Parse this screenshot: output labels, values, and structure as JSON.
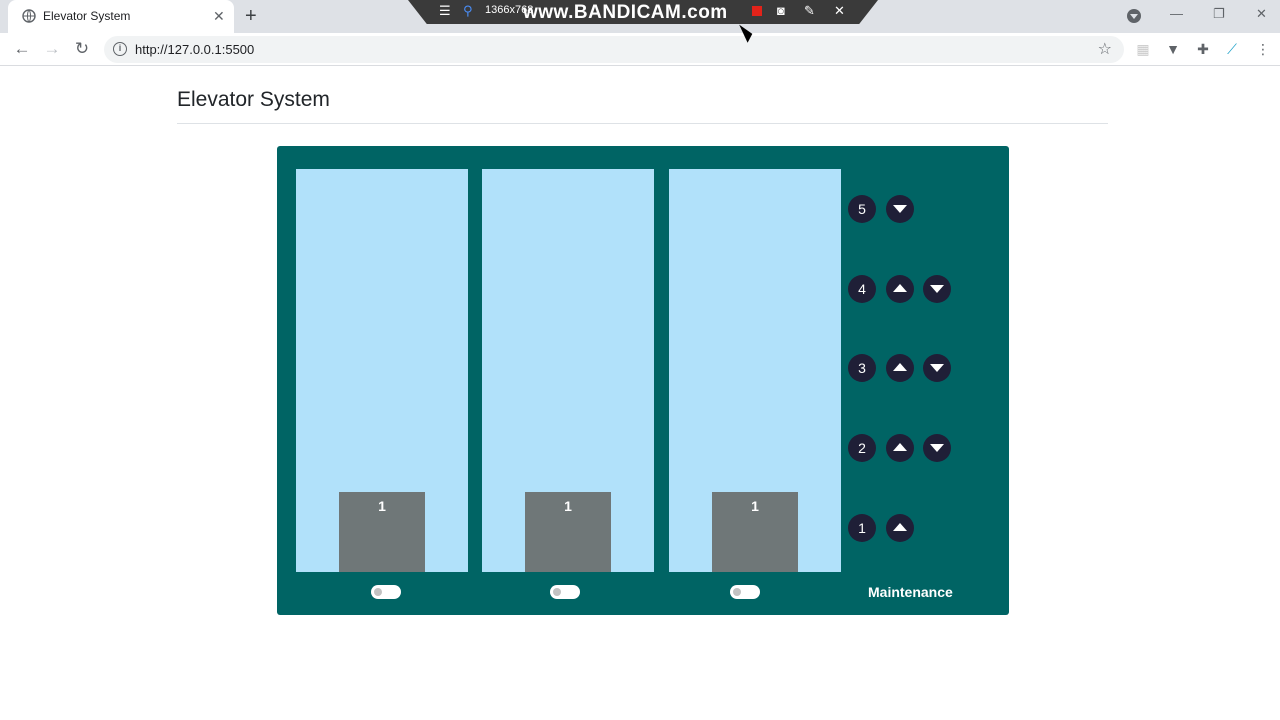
{
  "browser": {
    "tab_title": "Elevator System",
    "tab_close": "✕",
    "new_tab": "+",
    "url": "http://127.0.0.1:5500",
    "info_glyph": "i",
    "bookmark_star": "☆",
    "window_controls": {
      "minimize": "—",
      "restore": "❐",
      "close": "✕"
    },
    "nav": {
      "back": "←",
      "forward": "→",
      "reload": "↻"
    },
    "extensions": [
      "▦",
      "▼",
      "✚",
      "⟋",
      "⋮"
    ]
  },
  "recorder": {
    "menu_glyph": "☰",
    "pin_glyph": "⚲",
    "resolution": "1366x768",
    "watermark": "www.BANDICAM.com",
    "camera_glyph": "◙",
    "pen_glyph": "✎",
    "close_glyph": "✕"
  },
  "page": {
    "title": "Elevator System"
  },
  "elevators": [
    {
      "current_floor": "1",
      "maintenance": false
    },
    {
      "current_floor": "1",
      "maintenance": false
    },
    {
      "current_floor": "1",
      "maintenance": false
    }
  ],
  "floors": [
    {
      "number": "5",
      "up": false,
      "down": true
    },
    {
      "number": "4",
      "up": true,
      "down": true
    },
    {
      "number": "3",
      "up": true,
      "down": true
    },
    {
      "number": "2",
      "up": true,
      "down": true
    },
    {
      "number": "1",
      "up": true,
      "down": false
    }
  ],
  "maintenance_label": "Maintenance",
  "colors": {
    "panel": "#006464",
    "shaft": "#b1e1fa",
    "car": "#6f7778",
    "button": "#1f1f37"
  },
  "icons": {
    "up_arrow": "up-triangle-icon",
    "down_arrow": "down-triangle-icon"
  }
}
